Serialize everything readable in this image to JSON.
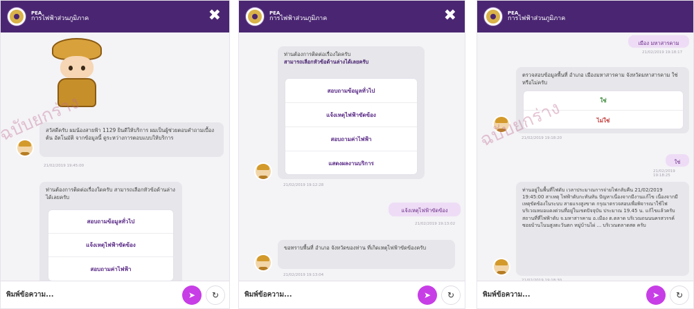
{
  "header": {
    "org_short": "PEA",
    "org_name": "การไฟฟ้าส่วนภูมิภาค",
    "close_icon": "✖"
  },
  "footer": {
    "placeholder": "พิมพ์ข้อความ..."
  },
  "panel1": {
    "greeting": "สวัสดีครับ ผมน้องสายฟ้า 1129 ยินดีให้บริการ ผมเป็นผู้ช่วยตอบคำถามเบื้องต้น อัตโนมัติ จากข้อมูลนี้ ดูระหว่างการตอบแบบให้บริการ",
    "greeting_time": "21/02/2019 19:45:00",
    "menu_prompt": "ท่านต้องการติดต่อเรื่องใดครับ สามารถเลือกหัวข้อด้านล่างได้เลยครับ",
    "options": [
      "สอบถามข้อมูลทั่วไป",
      "แจ้งเหตุไฟฟ้าขัดข้อง",
      "สอบถามค่าไฟฟ้า"
    ]
  },
  "panel2": {
    "menu_prompt": "ท่านต้องการติดต่อเรื่องใดครับ",
    "menu_prompt_bold": "สามารถเลือกหัวข้อด้านล่างได้เลยครับ",
    "options": [
      "สอบถามข้อมูลทั่วไป",
      "แจ้งเหตุไฟฟ้าขัดข้อง",
      "สอบถามค่าไฟฟ้า",
      "แสดงผลงานบริการ"
    ],
    "options_time": "21/02/2019 19:12:28",
    "user_msg": "แจ้งเหตุไฟฟ้าขัดข้อง",
    "user_time": "21/02/2019 19:13:02",
    "bot_msg": "ขอทราบพื้นที่ อำเภอ จังหวัดของท่าน ที่เกิดเหตุไฟฟ้าขัดข้องครับ",
    "bot_time": "21/02/2019 19:13:04"
  },
  "panel3": {
    "user_msg": "เมือง มหาสารคาม",
    "user_time": "21/02/2019 19:18:17",
    "confirm_msg": "ตรวจสอบข้อมูลพื้นที่ อำเภอ เมืองมหาสารคาม จังหวัดมหาสารคาม ใช่หรือไม่ครับ",
    "yes": "ใช่",
    "no": "ไม่ใช่",
    "confirm_time": "21/02/2019 19:18:20",
    "user2_msg": "ใช่",
    "user2_time": "21/02/2019 19:18:25",
    "bot_msg": "ท่านอยู่ในพื้นที่ไฟดับ เวลาประมาณการจ่ายไฟกลับคืน 21/02/2019 19:45:00 สาเหตุ ไฟฟ้าดับกะทันหัน ปัญหาเนื่องจากมีงานแก้ไข เนื่องจากมีเหตุขัดข้องในระบบ สายแรงสูงขาด กรุณาตรวจสอบเพื่อพิจารณาใช้ไฟ บริเวณหมอแดงด่วนที่อยู่ในเขตปัจจุบัน ประมาณ 19.45 น. แก้ไขแล้วครับ สถานที่ที่ไฟฟ้าดับ จ.มหาสารคาม อ.เมือง ต.ตลาด บริเวณถนนนครสวรรค์ ซอยบ้านโนนสูงตะวันตก หมู่บ้านไผ่ ... บริเวณตลาดสด ครับ",
    "bot_time": "21/02/2019 19:18:30"
  },
  "watermark": "ฉบับยกร่าง",
  "colors": {
    "header": "#4a2672",
    "send": "#c73ee6",
    "user_bubble": "#eedcf6"
  }
}
